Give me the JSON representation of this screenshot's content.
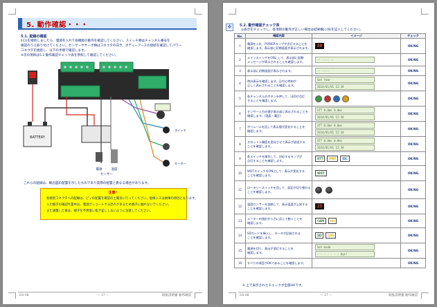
{
  "left_page": {
    "section_title": "5. 動作確認・・・",
    "subsection": "5.1. 配線の確認",
    "intro_lines": [
      "ECUを接続しましたら、電源を入れて各機能の動作を確認してください。スイッチ類はチャンネル番号を",
      "確認のうえ取り付けてください。センサーやサーボ類はコネクタの向き、ボディーアースの接続を確認してパワー",
      "コネクタを接続し、以下の手順で確認します。",
      "※次の項目は5.2 動作確認チェック表を参照して確認してください。"
    ],
    "diagram_labels": [
      "BATTERY",
      "電源",
      "温度",
      "センサー",
      "スイッチ",
      "モーター"
    ],
    "caption": "これらの配線は、概念図の配置を示したものであり実際の配置と異なる場合があります。",
    "warning": {
      "title": "注意！",
      "lines": [
        "各接続コネクタへの配線は、ピンの配置を確認の上確実に行ってください。配線ミスは故障の原因となります。",
        "入力端子の確認作業中は、電源がショートする恐れがあるため端子に触れないでください。",
        "また通電した後は、端子を不用意に抜き差ししないように注意してください。"
      ]
    },
    "footer": {
      "left": "DS-08",
      "center": "— 17 —",
      "right": "取扱説明書 動作確認"
    }
  },
  "right_page": {
    "subsection": "5.2. 動作確認チェック表",
    "intro": "◎表示をチェックし、各項目の動作が正しい場合は結果欄にOKを記入してください。",
    "columns": [
      "No.",
      "確認内容",
      "イメージ",
      "チェック"
    ],
    "rows": [
      {
        "no": "1",
        "lines": [
          "電源を入れ、POWERランプが点灯することを",
          "確認します。表示部に初期画面が表示されます。"
        ],
        "check": "OK/NG",
        "kind": "seg",
        "items": [
          "88"
        ]
      },
      {
        "no": "2",
        "lines": [
          "メインスイッチをONにして、表示部に起動",
          "メッセージが表示されることを確認します。"
        ],
        "check": "OK/NG",
        "kind": "lcd",
        "items": [
          "-- ---- --"
        ]
      },
      {
        "no": "3",
        "lines": [
          "表示部に初期画面が表示されます。"
        ],
        "check": "OK/NG",
        "kind": "lcd",
        "items": [
          "-- ----"
        ]
      },
      {
        "no": "4",
        "lines": [
          "時計表示を確認します。日付と時刻が",
          "正しく表示されることを確認します。"
        ],
        "check": "OK/NG",
        "kind": "lcd",
        "items": [
          "Set Year",
          "2014/01/01 12:34"
        ]
      },
      {
        "no": "5",
        "lines": [
          "各チャンネルのボタンを押して、LEDが点灯",
          "することを確認します。"
        ],
        "check": "OK/NG",
        "kind": "btn",
        "items": [
          "#3c9a48",
          "#c0392b",
          "#2c6fb6",
          "#d6a21b"
        ]
      },
      {
        "no": "6",
        "lines": [
          "センサー入力の値が表示部に表示されることを",
          "確認します。(温度・電圧)"
        ],
        "check": "OK/NG",
        "kind": "lcd",
        "items": [
          "STT 0.0ms 0.0ms",
          "2014/01/01 12:34"
        ]
      },
      {
        "no": "7",
        "lines": [
          "ボリュームを回して表示値が変化することを",
          "確認します。"
        ],
        "check": "OK/NG",
        "kind": "lcd",
        "items": [
          "STT 0.0ms 0.0ms",
          "2014/01/01 12:34"
        ]
      },
      {
        "no": "8",
        "lines": [
          "スロットル開度を変化させて表示が追従する",
          "ことを確認します。"
        ],
        "check": "OK/NG",
        "kind": "lcd",
        "items": [
          "STT 0.0ms 0.0ms",
          "2014/01/01 12:34"
        ]
      },
      {
        "no": "9",
        "lines": [
          "各スイッチを操作して、対応するランプが",
          "点灯することを確認します。"
        ],
        "check": "OK/NG",
        "kind": "tag",
        "items": [
          "STT",
          "PMP",
          "IDL"
        ]
      },
      {
        "no": "10",
        "lines": [
          "WOTスイッチをONにして、表示が変化する",
          "ことを確認します。"
        ],
        "check": "OK/NG",
        "kind": "tag",
        "items": [
          "WOT"
        ]
      },
      {
        "no": "11",
        "lines": [
          "ロータリースイッチを回して、設定が切り替わる",
          "ことを確認します。"
        ],
        "check": "OK/NG",
        "kind": "knob",
        "items": [
          "",
          ""
        ]
      },
      {
        "no": "12",
        "lines": [
          "温度センサーを加熱して、表示温度が上昇する",
          "ことを確認します。"
        ],
        "check": "OK/NG",
        "kind": "seg",
        "items": [
          "25"
        ]
      },
      {
        "no": "13",
        "lines": [
          "メーターの指針が入力に応じて動くことを",
          "確認します。"
        ],
        "check": "OK/NG",
        "kind": "tag",
        "items": [
          "CAM",
          "IGI"
        ]
      },
      {
        "no": "14",
        "lines": [
          "SDカードを挿入し、データが記録される",
          "ことを確認します。"
        ],
        "check": "OK/NG",
        "kind": "tag",
        "items": [
          "SD",
          "LOG"
        ]
      },
      {
        "no": "15",
        "lines": [
          "電源を切り、表示が消灯することを",
          "確認します。"
        ],
        "check": "OK/NG",
        "kind": "lcd",
        "items": [
          "Set mode",
          "- - - - - - - bye!"
        ]
      },
      {
        "no": "16",
        "lines": [
          "すべての項目がOKであることを確認します。"
        ],
        "check": "OK/NG",
        "kind": "none",
        "items": []
      }
    ],
    "note": "※ 上で表示されたチェックが全部OKです。",
    "footer": {
      "left": "DS-08",
      "center": "— 17 —",
      "right": "取扱説明書 動作確認"
    }
  }
}
